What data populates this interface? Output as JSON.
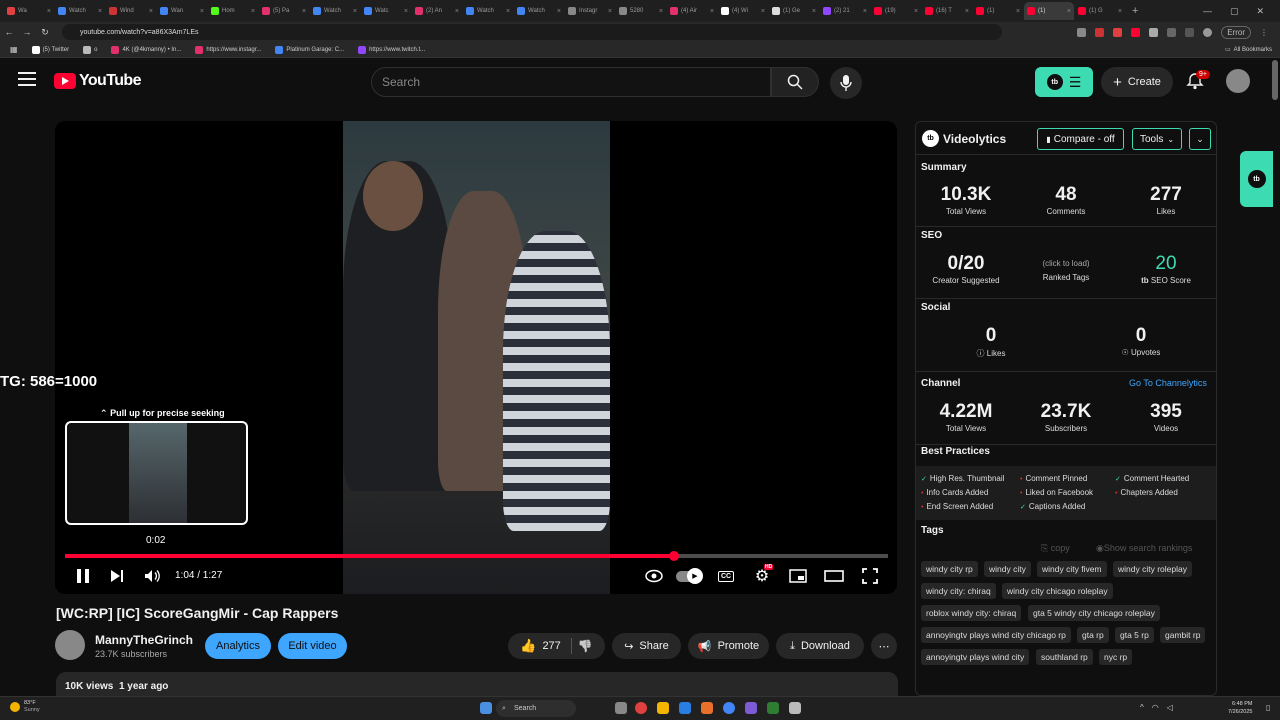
{
  "browser": {
    "tabs": [
      {
        "label": "Wa",
        "color": "#e04040"
      },
      {
        "label": "Watch",
        "color": "#4285f4"
      },
      {
        "label": "Wind",
        "color": "#cc3333"
      },
      {
        "label": "Wan",
        "color": "#4285f4"
      },
      {
        "label": "Hom",
        "color": "#53fc18"
      },
      {
        "label": "(5) Pa",
        "color": "#e1306c"
      },
      {
        "label": "Watch",
        "color": "#4285f4"
      },
      {
        "label": "Watc",
        "color": "#4285f4"
      },
      {
        "label": "(2) An",
        "color": "#e1306c"
      },
      {
        "label": "Watch",
        "color": "#4285f4"
      },
      {
        "label": "Watch",
        "color": "#4285f4"
      },
      {
        "label": "Instagr",
        "color": "#888888"
      },
      {
        "label": "5280",
        "color": "#888888"
      },
      {
        "label": "(4) Air",
        "color": "#e1306c"
      },
      {
        "label": "(4) Wi",
        "color": "#ffffff"
      },
      {
        "label": "(1) Ge",
        "color": "#dddddd"
      },
      {
        "label": "(2) 21",
        "color": "#9146ff"
      },
      {
        "label": "(19)",
        "color": "#ff0033"
      },
      {
        "label": "(16) T",
        "color": "#ff0033"
      },
      {
        "label": "(1)",
        "color": "#ff0033"
      },
      {
        "label": "(1)",
        "color": "#ff0033"
      },
      {
        "label": "(1) G",
        "color": "#ff0033"
      }
    ],
    "url": "youtube.com/watch?v=a86X3Am7LEs",
    "error_label": "Error",
    "bookmarks": [
      "(5) Twitter",
      "o",
      "4K (@4kmanny) • In...",
      "https://www.instagr...",
      "Platinum Garage: C...",
      "https://www.twitch.t..."
    ],
    "all_bookmarks": "All Bookmarks"
  },
  "header": {
    "logo_text": "YouTube",
    "search_placeholder": "Search",
    "create_label": "Create",
    "notif_count": "9+"
  },
  "player": {
    "seek_hint": "Pull up for precise seeking",
    "preview_time": "0:02",
    "overlay_text": "TG: 586=1000",
    "current_time": "1:04",
    "duration": "1:27",
    "time_display": "1:04 / 1:27",
    "progress_fraction": 0.74,
    "hd_badge": "HD"
  },
  "video": {
    "title": "[WC:RP] [IC] ScoreGangMir - Cap Rappers",
    "channel_name": "MannyTheGrinch",
    "subscribers": "23.7K subscribers",
    "analytics_label": "Analytics",
    "edit_label": "Edit video",
    "likes": "277",
    "share_label": "Share",
    "promote_label": "Promote",
    "download_label": "Download",
    "views": "10K views",
    "age": "1 year ago"
  },
  "videolytics": {
    "title": "Videolytics",
    "compare_label": "Compare - off",
    "tools_label": "Tools",
    "summary": {
      "heading": "Summary",
      "views_value": "10.3K",
      "views_label": "Total Views",
      "comments_value": "48",
      "comments_label": "Comments",
      "likes_value": "277",
      "likes_label": "Likes"
    },
    "seo": {
      "heading": "SEO",
      "creator_value": "0/20",
      "creator_label": "Creator Suggested",
      "ranked_hint": "(click to load)",
      "ranked_label": "Ranked Tags",
      "score_value": "20",
      "score_label": "SEO Score"
    },
    "social": {
      "heading": "Social",
      "likes_value": "0",
      "likes_label": "Likes",
      "upvotes_value": "0",
      "upvotes_label": "Upvotes"
    },
    "channel": {
      "heading": "Channel",
      "link": "Go To Channelytics",
      "views_value": "4.22M",
      "views_label": "Total Views",
      "subs_value": "23.7K",
      "subs_label": "Subscribers",
      "videos_value": "395",
      "videos_label": "Videos"
    },
    "best_practices": {
      "heading": "Best Practices",
      "items": [
        {
          "label": "High Res. Thumbnail",
          "ok": true
        },
        {
          "label": "Comment Pinned",
          "ok": false
        },
        {
          "label": "Comment Hearted",
          "ok": true
        },
        {
          "label": "Info Cards Added",
          "ok": false
        },
        {
          "label": "Liked on Facebook",
          "ok": false
        },
        {
          "label": "Chapters Added",
          "ok": false
        },
        {
          "label": "End Screen Added",
          "ok": false
        },
        {
          "label": "Captions Added",
          "ok": true
        }
      ]
    },
    "tags": {
      "heading": "Tags",
      "copy_label": "copy",
      "rankings_label": "Show search rankings",
      "items": [
        "windy city rp",
        "windy city",
        "windy city fivem",
        "windy city roleplay",
        "windy city: chiraq",
        "windy city chicago roleplay",
        "roblox windy city: chiraq",
        "gta 5 windy city chicago roleplay",
        "annoyingtv plays wind city chicago rp",
        "gta rp",
        "gta 5 rp",
        "gambit rp",
        "annoyingtv plays wind city",
        "southland rp",
        "nyc rp"
      ]
    }
  },
  "taskbar": {
    "weather_temp": "83°F",
    "weather_desc": "Sunny",
    "search_label": "Search",
    "time": "6:48 PM",
    "date": "7/26/2025"
  },
  "colors": {
    "yt_red": "#ff0033",
    "teal": "#3ddbb1",
    "blue_button": "#3ea6ff",
    "link_blue": "#3ea6ff"
  }
}
